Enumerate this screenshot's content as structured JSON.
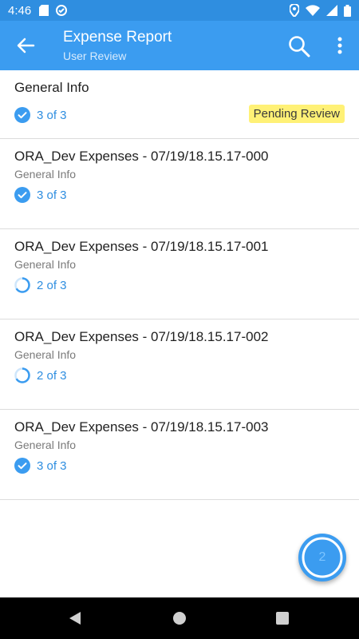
{
  "status_bar": {
    "time": "4:46"
  },
  "app_bar": {
    "title": "Expense Report",
    "subtitle": "User Review"
  },
  "general": {
    "title": "General Info",
    "progress": "3 of 3",
    "badge": "Pending Review"
  },
  "items": [
    {
      "title": "ORA_Dev Expenses - 07/19/18.15.17-000",
      "subtitle": "General Info",
      "progress": "3 of 3",
      "state": "complete"
    },
    {
      "title": "ORA_Dev Expenses - 07/19/18.15.17-001",
      "subtitle": "General Info",
      "progress": "2 of 3",
      "state": "partial"
    },
    {
      "title": "ORA_Dev Expenses - 07/19/18.15.17-002",
      "subtitle": "General Info",
      "progress": "2 of 3",
      "state": "partial"
    },
    {
      "title": "ORA_Dev Expenses - 07/19/18.15.17-003",
      "subtitle": "General Info",
      "progress": "3 of 3",
      "state": "complete"
    }
  ],
  "fab": {
    "count": "2"
  },
  "colors": {
    "primary": "#3b9cf0",
    "status_bar": "#2f8ee0",
    "accent_text": "#2f8ee0",
    "badge_bg": "#fff176"
  }
}
